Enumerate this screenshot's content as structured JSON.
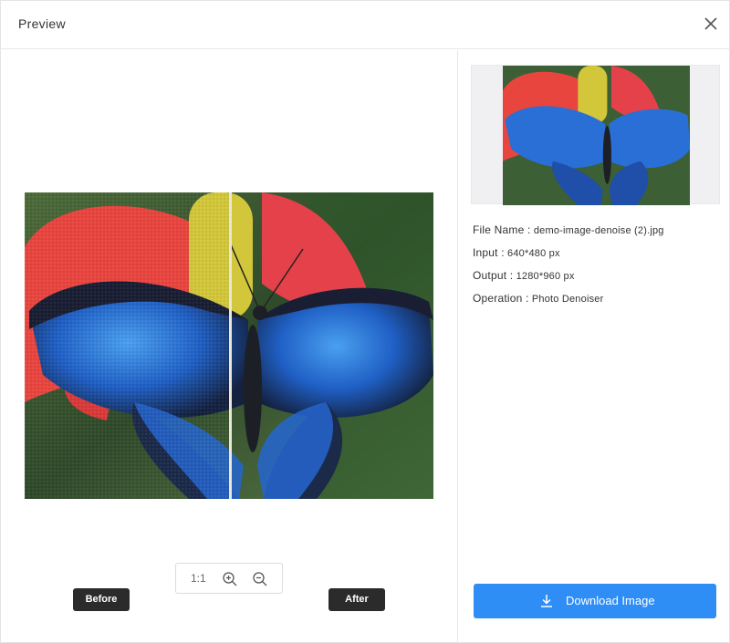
{
  "dialog": {
    "title": "Preview"
  },
  "icons": {
    "close": "close-icon",
    "zoom_in": "zoom-in-icon",
    "zoom_out": "zoom-out-icon",
    "download": "download-icon"
  },
  "viewer": {
    "zoom_ratio": "1:1",
    "before_label": "Before",
    "after_label": "After",
    "split_position": 0.5
  },
  "details": {
    "file_name_label": "File Name :",
    "file_name": "demo-image-denoise (2).jpg",
    "input_label": "Input :",
    "input": "640*480 px",
    "output_label": "Output :",
    "output": "1280*960 px",
    "operation_label": "Operation :",
    "operation": "Photo Denoiser"
  },
  "download_label": "Download Image",
  "colors": {
    "accent": "#2f8df6",
    "tag_background": "#2b2b2b",
    "divider": "#e8e8e8"
  }
}
